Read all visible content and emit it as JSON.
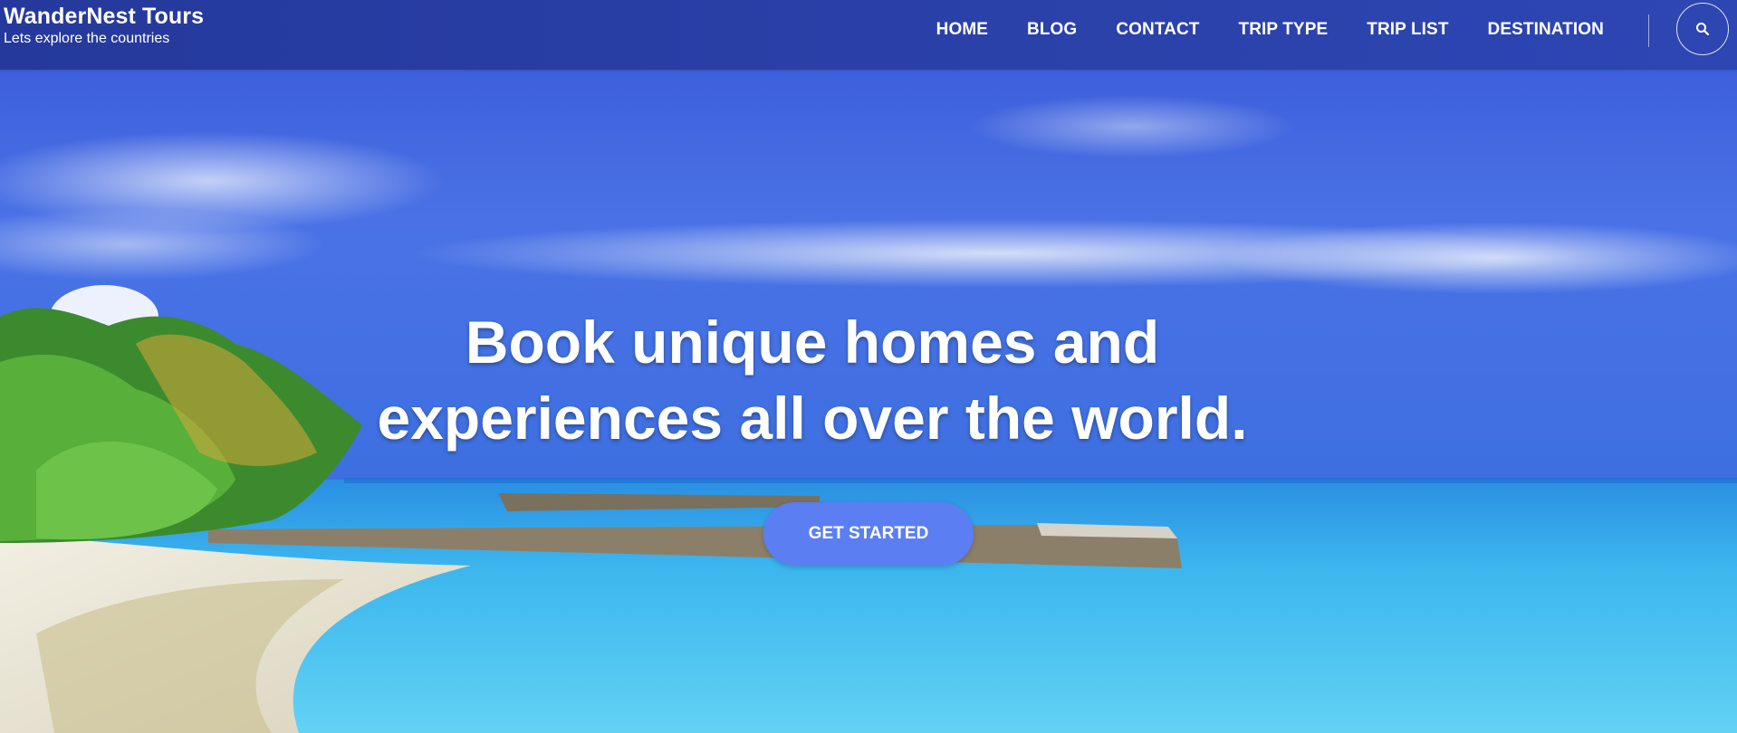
{
  "header": {
    "brand_title": "WanderNest Tours",
    "brand_tagline": "Lets explore the countries",
    "nav": [
      {
        "label": "HOME"
      },
      {
        "label": "BLOG"
      },
      {
        "label": "CONTACT"
      },
      {
        "label": "TRIP TYPE"
      },
      {
        "label": "TRIP LIST"
      },
      {
        "label": "DESTINATION"
      }
    ],
    "search_icon": "search-icon"
  },
  "hero": {
    "heading_line1": "Book unique homes and",
    "heading_line2": "experiences all over the world.",
    "cta_label": "GET STARTED",
    "background": "tropical-beach-photo"
  },
  "colors": {
    "header_bg": "#2a40a8",
    "cta_bg": "#5b7ef2",
    "text": "#ffffff"
  }
}
